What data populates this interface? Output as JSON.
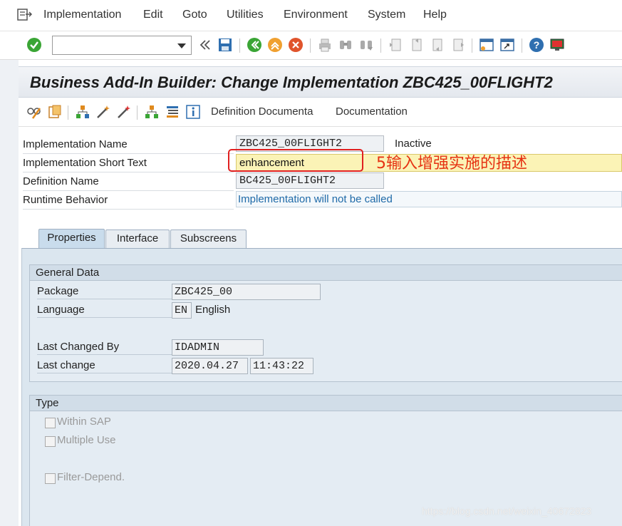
{
  "menu": {
    "items": [
      "Implementation",
      "Edit",
      "Goto",
      "Utilities",
      "Environment",
      "System",
      "Help"
    ]
  },
  "toolbar": {
    "command_value": "",
    "icons": [
      "enter-icon",
      "save-icon",
      "back-icon",
      "exit-icon",
      "cancel-icon",
      "print-icon",
      "find-icon",
      "find-next-icon",
      "first-page-icon",
      "prev-page-icon",
      "next-page-icon",
      "last-page-icon",
      "new-session-icon",
      "shortcut-icon",
      "help-icon",
      "layout-icon"
    ]
  },
  "title": "Business Add-In Builder: Change Implementation ZBC425_00FLIGHT2",
  "app_toolbar": {
    "definition_doc": "Definition Documenta",
    "documentation": "Documentation"
  },
  "header": {
    "impl_name_label": "Implementation Name",
    "impl_name": "ZBC425_00FLIGHT2",
    "status": "Inactive",
    "short_text_label": "Implementation Short Text",
    "short_text": "enhancement",
    "annotation": "5输入增强实施的描述",
    "def_name_label": "Definition Name",
    "def_name": "BC425_00FLIGHT2",
    "runtime_label": "Runtime Behavior",
    "runtime": "Implementation will not be called"
  },
  "tabs": [
    "Properties",
    "Interface",
    "Subscreens"
  ],
  "general": {
    "title": "General Data",
    "package_label": "Package",
    "package": "ZBC425_00",
    "language_label": "Language",
    "language_code": "EN",
    "language_name": "English",
    "changed_by_label": "Last Changed By",
    "changed_by": "IDADMIN",
    "last_change_label": "Last change",
    "last_change_date": "2020.04.27",
    "last_change_time": "11:43:22"
  },
  "type_group": {
    "title": "Type",
    "within_sap": "Within SAP",
    "multiple_use": "Multiple Use",
    "filter_depend": "Filter-Depend."
  },
  "watermark": "https://blog.csdn.net/weixin_40672823",
  "colors": {
    "accent_red": "#e02020",
    "input_yellow": "#fbf3b6",
    "panel_blue": "#dbe6ef"
  }
}
